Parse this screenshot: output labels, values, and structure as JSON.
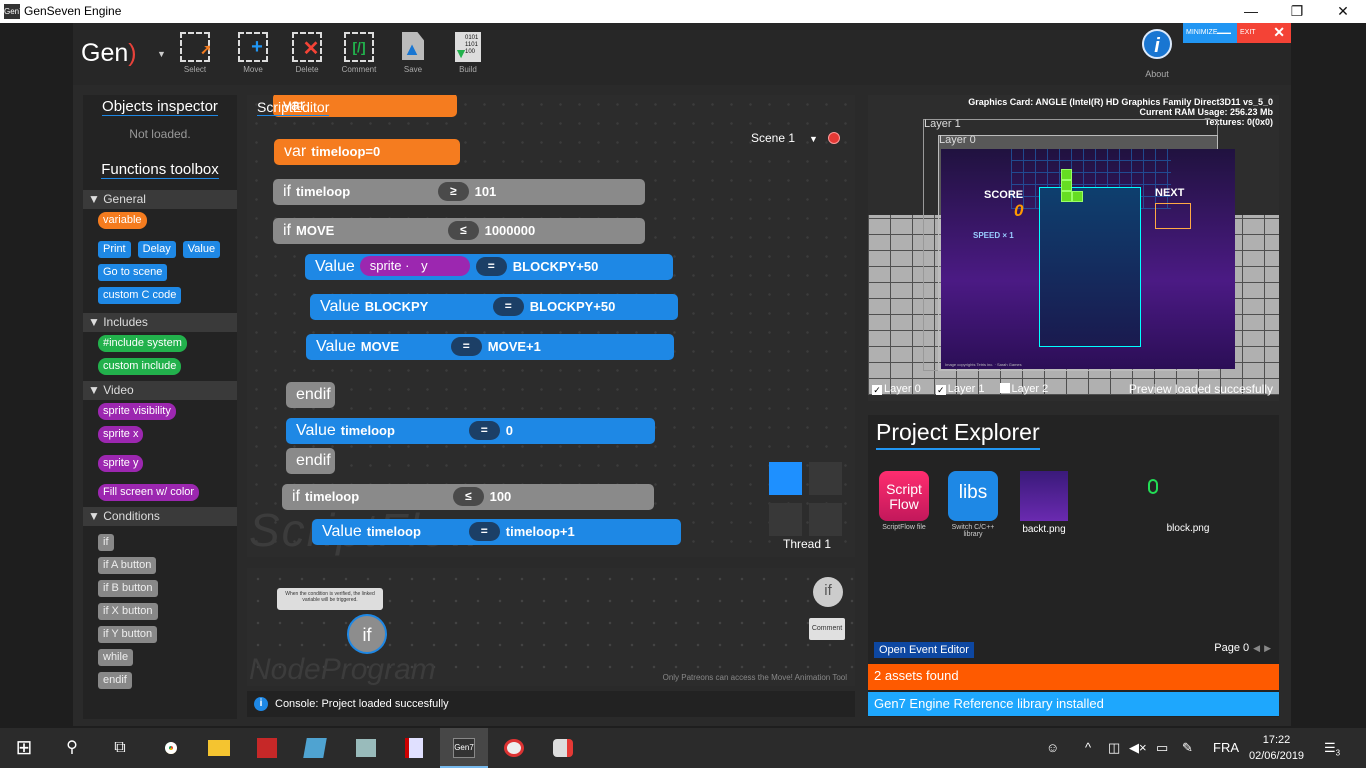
{
  "window": {
    "title": "GenSeven Engine",
    "icon_label": "Gen7",
    "min": "—",
    "max": "❐",
    "close": "✕"
  },
  "toolbar": {
    "logo": "Gen",
    "buttons": [
      {
        "label": "Select",
        "icon": "select-icon"
      },
      {
        "label": "Move",
        "icon": "move-icon"
      },
      {
        "label": "Delete",
        "icon": "delete-icon"
      },
      {
        "label": "Comment",
        "icon": "comment-icon"
      },
      {
        "label": "Save",
        "icon": "save-icon"
      },
      {
        "label": "Build",
        "icon": "build-icon",
        "text": "0101 1101 100"
      }
    ],
    "about": "About",
    "about_glyph": "i",
    "minimize": "MINIMIZE",
    "exit": "EXIT"
  },
  "inspector": {
    "title": "Objects inspector",
    "status": "Not loaded."
  },
  "functions": {
    "title": "Functions toolbox",
    "sections": [
      {
        "name": "General",
        "items": [
          "variable",
          "Print",
          "Delay",
          "Value",
          "Go to scene",
          "custom C code"
        ]
      },
      {
        "name": "Includes",
        "items": [
          "#include system",
          "custom include"
        ]
      },
      {
        "name": "Video",
        "items": [
          "sprite visibility",
          "sprite x",
          "sprite y",
          "Fill screen w/ color"
        ]
      },
      {
        "name": "Conditions",
        "items": [
          "if",
          "if A button",
          "if B button",
          "if X button",
          "if Y button",
          "while",
          "endif"
        ]
      }
    ]
  },
  "script": {
    "title": "ScriptEditor",
    "scene": "Scene 1",
    "thread": "Thread 1",
    "watermark": "ScriptFlow",
    "blocks": [
      {
        "kind": "var",
        "text": "var",
        "expr": ""
      },
      {
        "kind": "var",
        "text": "var",
        "expr": "timeloop=0"
      },
      {
        "kind": "if",
        "text": "if",
        "var": "timeloop",
        "op": "≥",
        "val": "101"
      },
      {
        "kind": "if",
        "text": "if",
        "var": "MOVE",
        "op": "≤",
        "val": "1000000"
      },
      {
        "kind": "value",
        "text": "Value",
        "sprite": "sprite",
        "sprite_dot": "·",
        "sprite_attr": "y",
        "op": "=",
        "val": "BLOCKPY+50"
      },
      {
        "kind": "value",
        "text": "Value",
        "var": "BLOCKPY",
        "op": "=",
        "val": "BLOCKPY+50"
      },
      {
        "kind": "value",
        "text": "Value",
        "var": "MOVE",
        "op": "=",
        "val": "MOVE+1"
      },
      {
        "kind": "endif",
        "text": "endif"
      },
      {
        "kind": "value",
        "text": "Value",
        "var": "timeloop",
        "op": "=",
        "val": "0"
      },
      {
        "kind": "endif",
        "text": "endif"
      },
      {
        "kind": "if",
        "text": "if",
        "var": "timeloop",
        "op": "≤",
        "val": "100"
      },
      {
        "kind": "value",
        "text": "Value",
        "var": "timeloop",
        "op": "=",
        "val": "timeloop+1"
      }
    ]
  },
  "node": {
    "watermark": "NodeProgram",
    "tooltip": "When the condition is verified, the linked variable will be triggered.",
    "if_label": "if",
    "comment": "Comment",
    "patreon_note": "Only Patreons can access the Move! Animation Tool"
  },
  "console": {
    "icon": "i",
    "message": "Console: Project loaded succesfully"
  },
  "preview": {
    "gpu": "Graphics Card: ANGLE (Intel(R) HD Graphics Family Direct3D11 vs_5_0",
    "ram": "Current RAM Usage: 256.23 Mb",
    "textures": "Textures: 0(0x0)",
    "layer1": "Layer 1",
    "layer0": "Layer 0",
    "game": {
      "score": "SCORE",
      "score_value": "0",
      "speed": "SPEED × 1",
      "next": "NEXT",
      "copyright": "Image copyrights Tetris inc. · Sarah Games"
    },
    "layers": [
      {
        "label": "Layer 0",
        "checked": "✓"
      },
      {
        "label": "Layer 1",
        "checked": "✓"
      },
      {
        "label": "Layer 2",
        "checked": ""
      }
    ],
    "status": "Preview loaded succesfully"
  },
  "project": {
    "title": "Project Explorer",
    "assets": [
      {
        "icon_text": "Script Flow",
        "caption": "ScriptFlow file"
      },
      {
        "icon_text": "libs",
        "caption": "Switch C/C++ library"
      },
      {
        "icon_text": "",
        "caption": "backt.png"
      },
      {
        "icon_text": "",
        "caption": "block.png"
      }
    ],
    "open_event": "Open Event Editor",
    "page": "Page 0",
    "page_prev": "◀",
    "page_next": "▶",
    "assets_found": "2 assets found",
    "reference": "Gen7 Engine Reference library installed"
  },
  "taskbar": {
    "start": "⊞",
    "search": "⚲",
    "taskview": "⧉",
    "tray": {
      "people": "☺",
      "up": "^",
      "network": "◫",
      "volume": "◀×",
      "battery": "▭",
      "pen": "✎",
      "lang": "FRA",
      "notif": "☰",
      "notif_count": "3"
    },
    "time": "17:22",
    "date": "02/06/2019"
  },
  "colors": {
    "orange": "#f57c1f",
    "blue": "#1e88e5",
    "green": "#22b14c",
    "purple": "#9c27b0",
    "gray": "#8a8a8a"
  }
}
